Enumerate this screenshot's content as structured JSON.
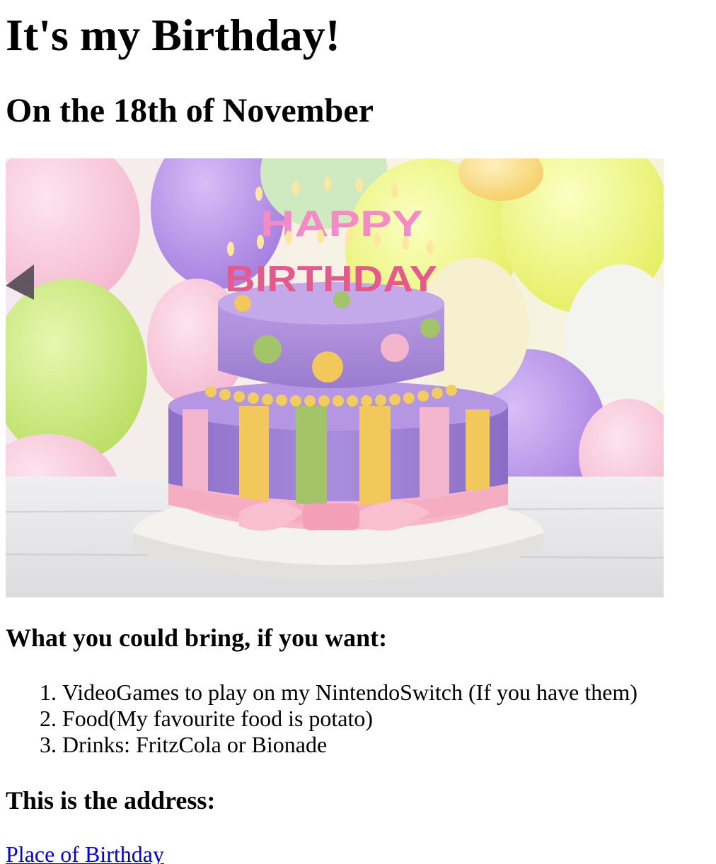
{
  "page": {
    "title": "It's my Birthday!",
    "subtitle": "On the 18th of November"
  },
  "image": {
    "icon": "birthday-cake-photo",
    "cake_lettering_top": "HAPPY",
    "cake_lettering_bottom": "BIRTHDAY",
    "colors": {
      "cake_purple": "#a88ad8",
      "stripe_yellow": "#f2c75c",
      "stripe_green": "#a4c46a",
      "stripe_pink": "#f4b6cc",
      "ribbon_pink": "#f6b8c8",
      "balloon_yellow": "#eef27a",
      "balloon_purple": "#b58be8"
    }
  },
  "bring": {
    "heading": "What you could bring, if you want:",
    "items": [
      "VideoGames to play on my NintendoSwitch (If you have them)",
      "Food(My favourite food is potato)",
      "Drinks: FritzCola or Bionade"
    ]
  },
  "address": {
    "heading": "This is the address:",
    "link_text": "Place of Birthday",
    "link_color": "#0000ee"
  }
}
